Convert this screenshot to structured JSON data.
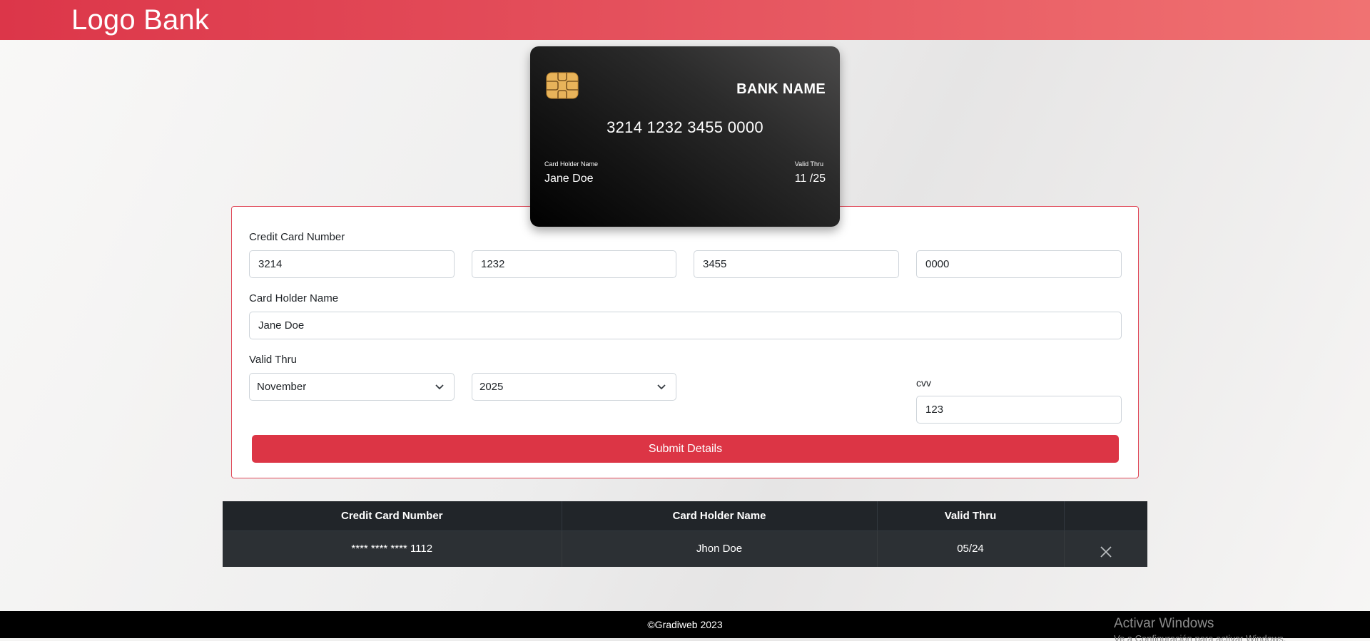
{
  "header": {
    "logo_text": "Logo Bank"
  },
  "card_preview": {
    "bank_name": "BANK NAME",
    "number": "3214 1232 3455 0000",
    "holder_caption": "Card Holder Name",
    "holder_name": "Jane Doe",
    "valid_caption": "Valid Thru",
    "valid_value": "11 /25",
    "chip_icon": "card-chip-icon"
  },
  "form": {
    "card_number_label": "Credit Card Number",
    "card_number_parts": [
      "3214",
      "1232",
      "3455",
      "0000"
    ],
    "holder_label": "Card Holder Name",
    "holder_value": "Jane Doe",
    "valid_label": "Valid Thru",
    "month_selected": "November",
    "year_selected": "2025",
    "cvv_label": "cvv",
    "cvv_value": "123",
    "submit_label": "Submit Details",
    "accent_color": "#dc3545"
  },
  "table": {
    "headers": [
      "Credit Card Number",
      "Card Holder Name",
      "Valid Thru",
      ""
    ],
    "rows": [
      {
        "number": "**** **** **** 1112",
        "holder": "Jhon Doe",
        "valid": "05/24",
        "action_icon": "close-icon"
      }
    ]
  },
  "footer": {
    "text": "©Gradiweb 2023"
  },
  "watermark": {
    "title": "Activar Windows",
    "subtitle": "Ve a Configuración para activar Windows."
  }
}
